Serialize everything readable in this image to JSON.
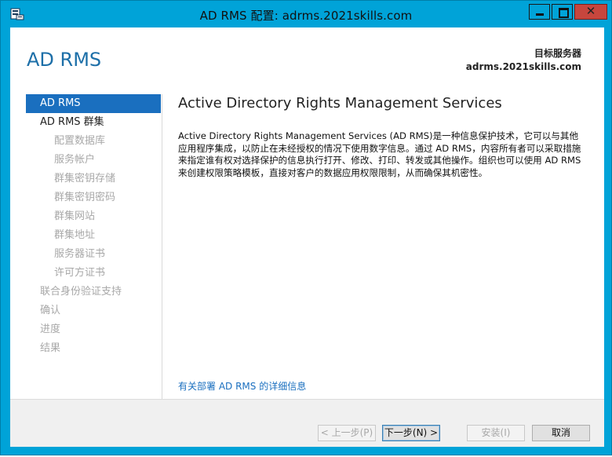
{
  "window": {
    "title": "AD RMS 配置: adrms.2021skills.com",
    "minimize_label": "",
    "close_glyph": "✕",
    "accent_color": "#00a3d8",
    "app_icon": "server-manager-icon"
  },
  "header": {
    "app_title": "AD RMS",
    "destination_label": "目标服务器",
    "destination_server": "adrms.2021skills.com"
  },
  "nav": {
    "items": [
      {
        "label": "AD RMS",
        "state": "active"
      },
      {
        "label": "AD RMS 群集",
        "state": "enabled"
      },
      {
        "label": "配置数据库",
        "state": "disabled"
      },
      {
        "label": "服务帐户",
        "state": "disabled"
      },
      {
        "label": "群集密钥存储",
        "state": "disabled"
      },
      {
        "label": "群集密钥密码",
        "state": "disabled"
      },
      {
        "label": "群集网站",
        "state": "disabled"
      },
      {
        "label": "群集地址",
        "state": "disabled"
      },
      {
        "label": "服务器证书",
        "state": "disabled"
      },
      {
        "label": "许可方证书",
        "state": "disabled"
      },
      {
        "label": "联合身份验证支持",
        "state": "disabled"
      },
      {
        "label": "确认",
        "state": "disabled"
      },
      {
        "label": "进度",
        "state": "disabled"
      },
      {
        "label": "结果",
        "state": "disabled"
      }
    ]
  },
  "content": {
    "title": "Active Directory Rights Management Services",
    "description": "Active Directory Rights Management Services (AD RMS)是一种信息保护技术，它可以与其他应用程序集成，以防止在未经授权的情况下使用数字信息。通过 AD RMS，内容所有者可以采取措施来指定谁有权对选择保护的信息执行打开、修改、打印、转发或其他操作。组织也可以使用 AD RMS 来创建权限策略模板，直接对客户的数据应用权限限制，从而确保其机密性。",
    "more_info_link": "有关部署 AD RMS 的详细信息"
  },
  "footer": {
    "prev_label": "< 上一步(P)",
    "next_label": "下一步(N) >",
    "install_label": "安装(I)",
    "cancel_label": "取消"
  }
}
